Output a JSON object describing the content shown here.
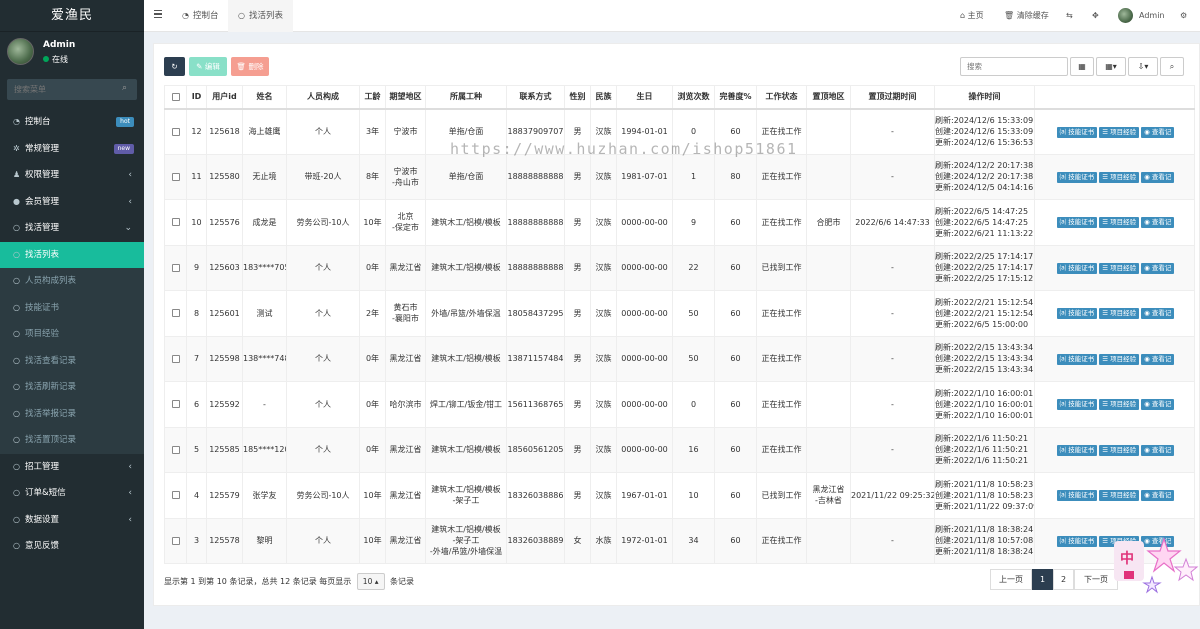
{
  "app": {
    "title": "爱渔民"
  },
  "user": {
    "name": "Admin",
    "status": "在线"
  },
  "sidebar": {
    "search_placeholder": "搜索菜单",
    "items": [
      {
        "label": "控制台",
        "badge": "hot"
      },
      {
        "label": "常规管理",
        "badge": "new"
      },
      {
        "label": "权限管理",
        "caret": "‹"
      },
      {
        "label": "会员管理",
        "caret": "‹"
      },
      {
        "label": "找活管理",
        "caret": "⌄"
      }
    ],
    "sub_items": [
      {
        "label": "找活列表"
      },
      {
        "label": "人员构成列表"
      },
      {
        "label": "技能证书"
      },
      {
        "label": "项目经验"
      },
      {
        "label": "找活查看记录"
      },
      {
        "label": "找活刷新记录"
      },
      {
        "label": "找活举报记录"
      },
      {
        "label": "找活置顶记录"
      }
    ],
    "items_after": [
      {
        "label": "招工管理",
        "caret": "‹"
      },
      {
        "label": "订单&短信",
        "caret": "‹"
      },
      {
        "label": "数据设置",
        "caret": "‹"
      },
      {
        "label": "意见反馈"
      }
    ]
  },
  "header": {
    "tabs": [
      {
        "label": "控制台"
      },
      {
        "label": "找活列表"
      }
    ],
    "right": {
      "home": "主页",
      "clear_cache": "清除缓存",
      "admin": "Admin"
    }
  },
  "toolbar": {
    "edit": "编辑",
    "delete": "删除",
    "search_placeholder": "搜索"
  },
  "table": {
    "headers": [
      "ID",
      "用户id",
      "姓名",
      "人员构成",
      "工龄",
      "期望地区",
      "所属工种",
      "联系方式",
      "性别",
      "民族",
      "生日",
      "浏览次数",
      "完善度%",
      "工作状态",
      "置顶地区",
      "置顶过期时间",
      "操作时间"
    ],
    "op_buttons": [
      "技能证书",
      "项目经验",
      "查看记"
    ],
    "rows": [
      {
        "id": "12",
        "uid": "125618",
        "name": "海上雄鹰",
        "comp": "个人",
        "age": "3年",
        "area": [
          "宁波市"
        ],
        "job": [
          "单拖/仓面"
        ],
        "phone": "18837909707",
        "sex": "男",
        "nation": "汉族",
        "birth": "1994-01-01",
        "views": "0",
        "complete": "60",
        "status": "正在找工作",
        "top_area": "",
        "top_exp": "-",
        "t1": "刷新:2024/12/6 15:33:09",
        "t2": "创建:2024/12/6 15:33:09",
        "t3": "更新:2024/12/6 15:36:53"
      },
      {
        "id": "11",
        "uid": "125580",
        "name": "无止境",
        "comp": "带班-20人",
        "age": "8年",
        "area": [
          "宁波市",
          "-舟山市"
        ],
        "job": [
          "单拖/仓面"
        ],
        "phone": "18888888888",
        "sex": "男",
        "nation": "汉族",
        "birth": "1981-07-01",
        "views": "1",
        "complete": "80",
        "status": "正在找工作",
        "top_area": "",
        "top_exp": "-",
        "t1": "刷新:2024/12/2 20:17:38",
        "t2": "创建:2024/12/2 20:17:38",
        "t3": "更新:2024/12/5 04:14:16"
      },
      {
        "id": "10",
        "uid": "125576",
        "name": "成龙是",
        "comp": "劳务公司-10人",
        "age": "10年",
        "area": [
          "北京",
          "-保定市"
        ],
        "job": [
          "建筑木工/铝模/模板"
        ],
        "phone": "18888888888",
        "sex": "男",
        "nation": "汉族",
        "birth": "0000-00-00",
        "views": "9",
        "complete": "60",
        "status": "正在找工作",
        "top_area": "合肥市",
        "top_exp": "2022/6/6 14:47:33",
        "t1": "刷新:2022/6/5 14:47:25",
        "t2": "创建:2022/6/5 14:47:25",
        "t3": "更新:2022/6/21 11:13:22"
      },
      {
        "id": "9",
        "uid": "125603",
        "name": "183****7056",
        "comp": "个人",
        "age": "0年",
        "area": [
          "黑龙江省"
        ],
        "job": [
          "建筑木工/铝模/模板"
        ],
        "phone": "18888888888",
        "sex": "男",
        "nation": "汉族",
        "birth": "0000-00-00",
        "views": "22",
        "complete": "60",
        "status": "已找到工作",
        "top_area": "",
        "top_exp": "-",
        "t1": "刷新:2022/2/25 17:14:17",
        "t2": "创建:2022/2/25 17:14:17",
        "t3": "更新:2022/2/25 17:15:12"
      },
      {
        "id": "8",
        "uid": "125601",
        "name": "测试",
        "comp": "个人",
        "age": "2年",
        "area": [
          "黄石市",
          "-襄阳市"
        ],
        "job": [
          "外墙/吊篮/外墙保温"
        ],
        "phone": "18058437295",
        "sex": "男",
        "nation": "汉族",
        "birth": "0000-00-00",
        "views": "50",
        "complete": "60",
        "status": "正在找工作",
        "top_area": "",
        "top_exp": "-",
        "t1": "刷新:2022/2/21 15:12:54",
        "t2": "创建:2022/2/21 15:12:54",
        "t3": "更新:2022/6/5 15:00:00"
      },
      {
        "id": "7",
        "uid": "125598",
        "name": "138****7484",
        "comp": "个人",
        "age": "0年",
        "area": [
          "黑龙江省"
        ],
        "job": [
          "建筑木工/铝模/模板"
        ],
        "phone": "13871157484",
        "sex": "男",
        "nation": "汉族",
        "birth": "0000-00-00",
        "views": "50",
        "complete": "60",
        "status": "正在找工作",
        "top_area": "",
        "top_exp": "-",
        "t1": "刷新:2022/2/15 13:43:34",
        "t2": "创建:2022/2/15 13:43:34",
        "t3": "更新:2022/2/15 13:43:34"
      },
      {
        "id": "6",
        "uid": "125592",
        "name": "-",
        "comp": "个人",
        "age": "0年",
        "area": [
          "哈尔滨市"
        ],
        "job": [
          "焊工/铆工/钣金/钳工"
        ],
        "phone": "15611368765",
        "sex": "男",
        "nation": "汉族",
        "birth": "0000-00-00",
        "views": "0",
        "complete": "60",
        "status": "正在找工作",
        "top_area": "",
        "top_exp": "-",
        "t1": "刷新:2022/1/10 16:00:01",
        "t2": "创建:2022/1/10 16:00:01",
        "t3": "更新:2022/1/10 16:00:01"
      },
      {
        "id": "5",
        "uid": "125585",
        "name": "185****1205",
        "comp": "个人",
        "age": "0年",
        "area": [
          "黑龙江省"
        ],
        "job": [
          "建筑木工/铝模/模板"
        ],
        "phone": "18560561205",
        "sex": "男",
        "nation": "汉族",
        "birth": "0000-00-00",
        "views": "16",
        "complete": "60",
        "status": "正在找工作",
        "top_area": "",
        "top_exp": "-",
        "t1": "刷新:2022/1/6 11:50:21",
        "t2": "创建:2022/1/6 11:50:21",
        "t3": "更新:2022/1/6 11:50:21"
      },
      {
        "id": "4",
        "uid": "125579",
        "name": "张学友",
        "comp": "劳务公司-10人",
        "age": "10年",
        "area": [
          "黑龙江省"
        ],
        "job": [
          "建筑木工/铝模/模板",
          "-架子工"
        ],
        "phone": "18326038886",
        "sex": "男",
        "nation": "汉族",
        "birth": "1967-01-01",
        "views": "10",
        "complete": "60",
        "status": "已找到工作",
        "top_area": "黑龙江省\n-吉林省",
        "top_exp": "2021/11/22 09:25:32",
        "t1": "刷新:2021/11/8 10:58:23",
        "t2": "创建:2021/11/8 10:58:23",
        "t3": "更新:2021/11/22 09:37:09"
      },
      {
        "id": "3",
        "uid": "125578",
        "name": "黎明",
        "comp": "个人",
        "age": "10年",
        "area": [
          "黑龙江省"
        ],
        "job": [
          "建筑木工/铝模/模板",
          "-架子工",
          "-外墙/吊篮/外墙保温"
        ],
        "phone": "18326038889",
        "sex": "女",
        "nation": "水族",
        "birth": "1972-01-01",
        "views": "34",
        "complete": "60",
        "status": "正在找工作",
        "top_area": "",
        "top_exp": "-",
        "t1": "刷新:2021/11/8 18:38:24",
        "t2": "创建:2021/11/8 10:57:08",
        "t3": "更新:2021/11/8 18:38:24"
      }
    ]
  },
  "footer": {
    "info_prefix": "显示第 1 到第 10 条记录，总共 12 条记录 每页显示",
    "page_size": "10",
    "info_suffix": "条记录"
  },
  "pagination": {
    "prev": "上一页",
    "pages": [
      "1",
      "2"
    ],
    "next": "下一页"
  },
  "watermark": "https://www.huzhan.com/ishop51861",
  "float": {
    "char": "中"
  }
}
